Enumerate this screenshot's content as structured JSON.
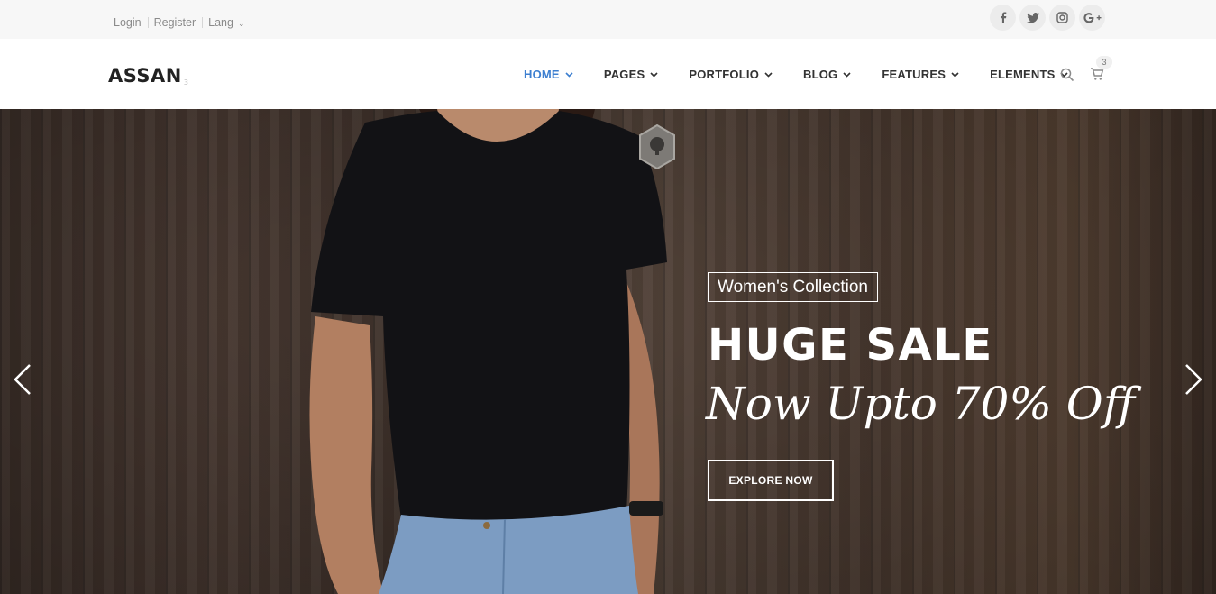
{
  "topbar": {
    "login": "Login",
    "register": "Register",
    "lang": "Lang",
    "socials": [
      "facebook-icon",
      "twitter-icon",
      "instagram-icon",
      "google-plus-icon"
    ]
  },
  "nav": {
    "logo": "ASSAN",
    "logo_sup": "3",
    "items": [
      {
        "label": "HOME",
        "active": true
      },
      {
        "label": "PAGES"
      },
      {
        "label": "PORTFOLIO"
      },
      {
        "label": "BLOG"
      },
      {
        "label": "FEATURES"
      },
      {
        "label": "ELEMENTS"
      }
    ],
    "cart_count": "3"
  },
  "hero": {
    "tag": "Women's Collection",
    "headline": "HUGE SALE",
    "subline": "Now Upto 70% Off",
    "cta": "EXPLORE NOW"
  },
  "colors": {
    "accent": "#3d7fd0",
    "text_dark": "#333333",
    "topbar_bg": "#f7f7f7"
  }
}
